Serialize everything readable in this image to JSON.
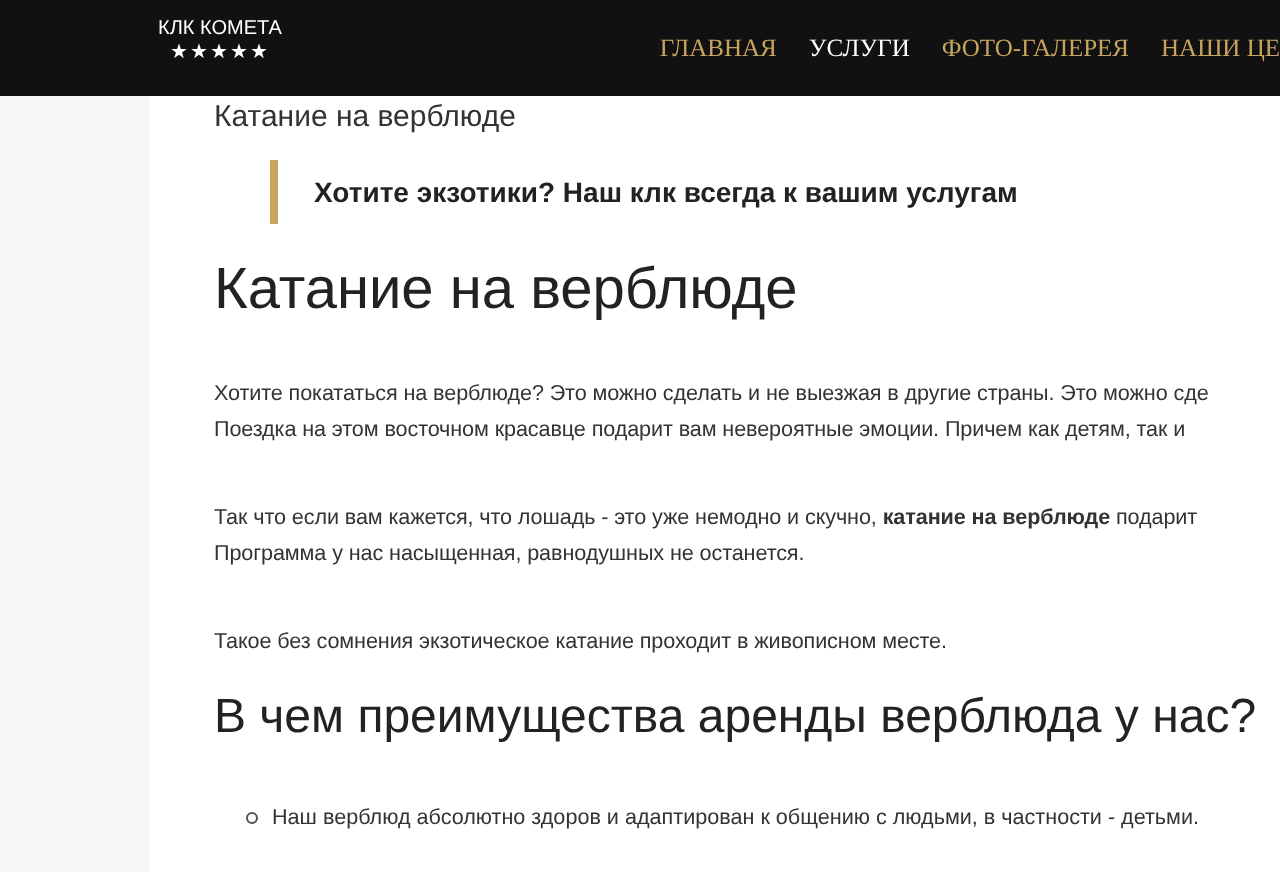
{
  "header": {
    "logo": {
      "title": "КЛК КОМЕТА",
      "stars": "★★★★★"
    },
    "nav": [
      {
        "label": "ГЛАВНАЯ",
        "selected": false
      },
      {
        "label": "УСЛУГИ",
        "selected": true
      },
      {
        "label": "ФОТО-ГАЛЕРЕЯ",
        "selected": false
      },
      {
        "label": "НАШИ ЦЕ",
        "selected": false
      }
    ]
  },
  "page_title": "Катание на верблюде",
  "quote": "Хотите экзотики? Наш клк всегда к вашим услугам",
  "heading": "Катание на верблюде",
  "paragraphs": [
    [
      "Хотите покататься на верблюде? Это можно сделать и не выезжая в другие страны. Это можно сде",
      "Поездка на этом восточном красавце подарит вам невероятные эмоции.  Причем как детям, так и"
    ],
    [
      "Так что если вам кажется, что лошадь - это уже немодно и скучно, **катание на верблюде** подарит",
      "Программа у нас насыщенная, равнодушных не останется."
    ],
    [
      "Такое без сомнения экзотическое катание проходит в живописном месте."
    ]
  ],
  "subheading": "В чем преимущества аренды верблюда у  нас?",
  "bullets": [
    "Наш верблюд абсолютно здоров и адаптирован к общению с людьми, в частности - детьми."
  ]
}
